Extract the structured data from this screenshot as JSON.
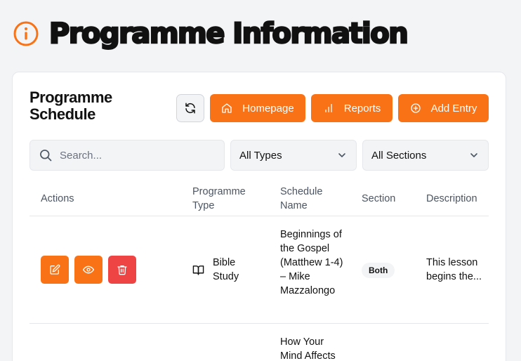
{
  "page": {
    "title": "Programme Information"
  },
  "card": {
    "title": "Programme Schedule"
  },
  "toolbar": {
    "homepage_label": "Homepage",
    "reports_label": "Reports",
    "add_label": "Add Entry"
  },
  "filters": {
    "search_placeholder": "Search...",
    "type_selected": "All Types",
    "section_selected": "All Sections"
  },
  "table": {
    "headers": [
      "Actions",
      "Programme Type",
      "Schedule Name",
      "Section",
      "Description"
    ],
    "rows": [
      {
        "type": "Bible Study",
        "type_icon": "book-icon",
        "schedule": "Beginnings of the Gospel (Matthew 1-4) – Mike Mazzalongo",
        "section": "Both",
        "description": "This lesson begins the..."
      },
      {
        "schedule": "How Your Mind Affects"
      }
    ]
  },
  "colors": {
    "accent": "#f97316",
    "danger": "#ef4444",
    "background": "#f3f4f6"
  }
}
